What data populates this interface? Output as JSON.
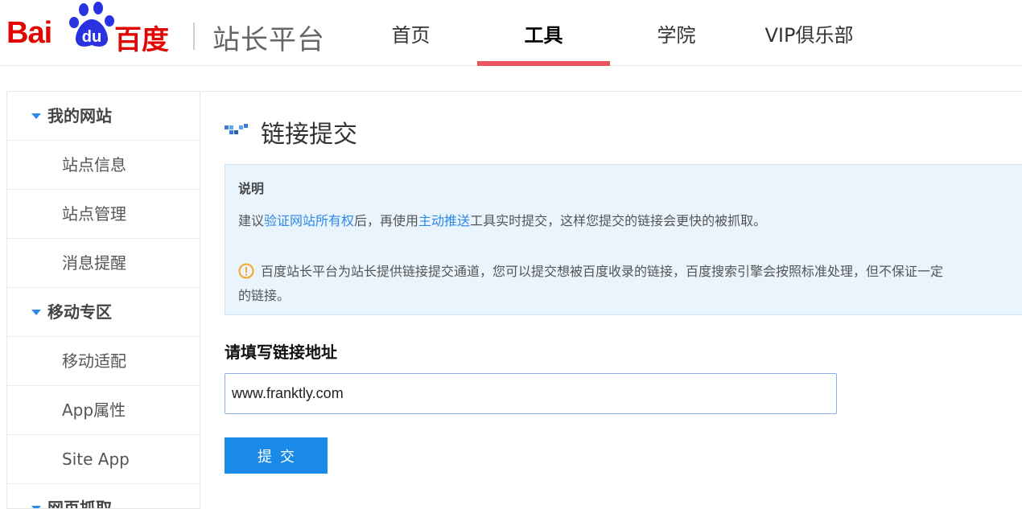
{
  "header": {
    "logo_bai": "Bai",
    "logo_du": "du",
    "logo_cn": "百度",
    "platform_name": "站长平台",
    "nav": [
      {
        "label": "首页"
      },
      {
        "label": "工具"
      },
      {
        "label": "学院"
      },
      {
        "label": "VIP俱乐部"
      }
    ],
    "active_nav": "工具",
    "accent_color": "#e9545d"
  },
  "sidebar": {
    "groups": [
      {
        "label": "我的网站",
        "items": [
          "站点信息",
          "站点管理",
          "消息提醒"
        ]
      },
      {
        "label": "移动专区",
        "items": [
          "移动适配",
          "App属性",
          "Site App"
        ]
      },
      {
        "label": "网页抓取",
        "items": []
      }
    ]
  },
  "main": {
    "title": "链接提交",
    "notice": {
      "heading": "说明",
      "line1_pre": "建议",
      "line1_link1": "验证网站所有权",
      "line1_mid": "后，再使用",
      "line1_link2": "主动推送",
      "line1_post": "工具实时提交，这样您提交的链接会更快的被抓取。",
      "warning_line": "百度站长平台为站长提供链接提交通道，您可以提交想被百度收录的链接，百度搜索引擎会按照标准处理，但不保证一定",
      "warning_line_cont": "的链接。"
    },
    "form": {
      "label": "请填写链接地址",
      "url_value": "www.franktly.com",
      "submit_label": "提交"
    }
  },
  "icons": {
    "title_icon": "checkmark-pixels-icon",
    "warning_icon": "warning-circle-icon",
    "sidebar_toggle": "triangle-down-icon"
  }
}
